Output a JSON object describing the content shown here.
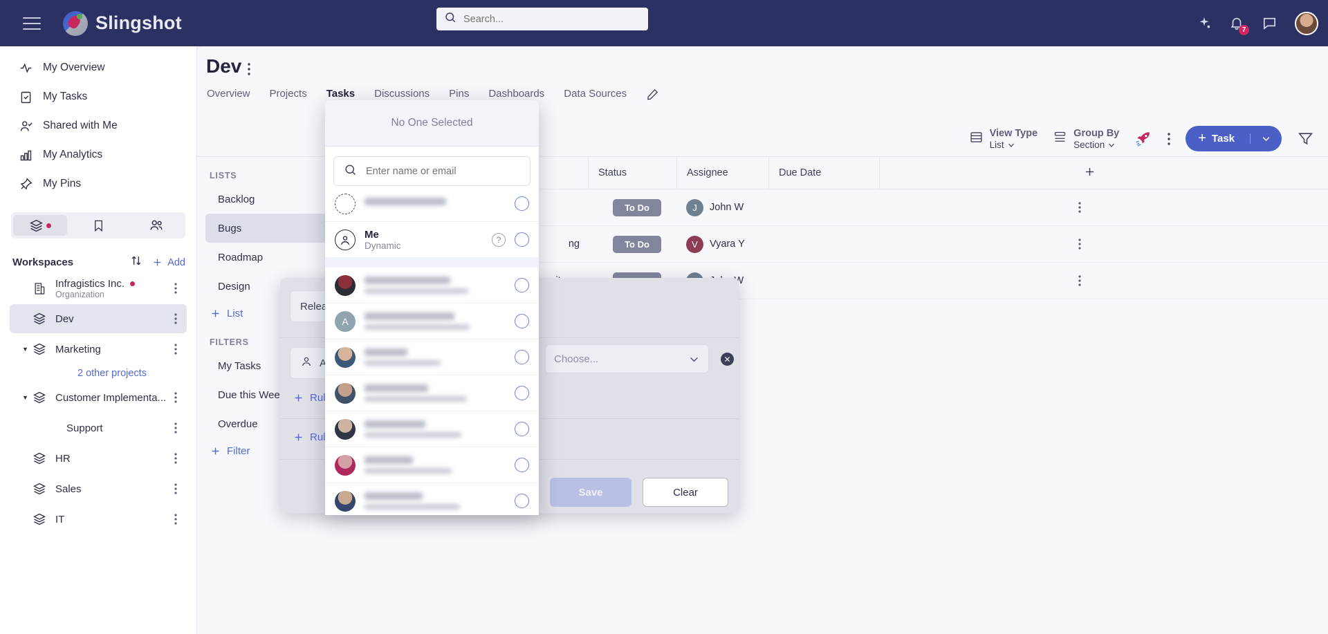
{
  "app": {
    "name": "Slingshot",
    "menu_icon": "hamburger-icon",
    "logo_icon": "slingshot-rocket-logo"
  },
  "search": {
    "placeholder": "Search...",
    "value": "",
    "icon": "search-icon"
  },
  "topbar_icons": {
    "ai_label": "sparkle-icon",
    "notifications_label": "bell-icon",
    "notifications_count": "7",
    "chat_label": "chat-icon",
    "avatar_label": "user-avatar"
  },
  "sidebar": {
    "nav": [
      {
        "label": "My Overview",
        "icon": "activity-icon"
      },
      {
        "label": "My Tasks",
        "icon": "clipboard-check-icon"
      },
      {
        "label": "Shared with Me",
        "icon": "user-check-icon"
      },
      {
        "label": "My Analytics",
        "icon": "bar-chart-icon"
      },
      {
        "label": "My Pins",
        "icon": "pin-icon"
      }
    ],
    "segments": [
      {
        "name": "workspaces-tab",
        "icon": "layers-icon",
        "active": true,
        "dot": true
      },
      {
        "name": "bookmarks-tab",
        "icon": "bookmark-icon",
        "active": false,
        "dot": false
      },
      {
        "name": "people-tab",
        "icon": "people-icon",
        "active": false,
        "dot": false
      }
    ],
    "workspaces_title": "Workspaces",
    "sort_label": "sort-icon",
    "add_label": "Add",
    "items": [
      {
        "label": "Infragistics Inc.",
        "sub": "Organization",
        "icon": "building-icon",
        "dot": true,
        "selected": false,
        "caret": false,
        "indent": 0
      },
      {
        "label": "Dev",
        "sub": "",
        "icon": "layers-icon",
        "dot": false,
        "selected": true,
        "caret": false,
        "indent": 0
      },
      {
        "label": "Marketing",
        "sub": "",
        "icon": "layers-icon",
        "dot": false,
        "selected": false,
        "caret": true,
        "indent": 0
      },
      {
        "label": "Customer Implementa...",
        "sub": "",
        "icon": "layers-icon",
        "dot": false,
        "selected": false,
        "caret": true,
        "indent": 0
      },
      {
        "label": "Support",
        "sub": "",
        "icon": "",
        "dot": false,
        "selected": false,
        "caret": false,
        "indent": 1
      },
      {
        "label": "HR",
        "sub": "",
        "icon": "layers-icon",
        "dot": false,
        "selected": false,
        "caret": false,
        "indent": 0
      },
      {
        "label": "Sales",
        "sub": "",
        "icon": "layers-icon",
        "dot": false,
        "selected": false,
        "caret": false,
        "indent": 0
      },
      {
        "label": "IT",
        "sub": "",
        "icon": "layers-icon",
        "dot": false,
        "selected": false,
        "caret": false,
        "indent": 0
      }
    ],
    "other_projects": "2 other projects"
  },
  "main": {
    "title": "Dev",
    "tabs": [
      {
        "label": "Overview",
        "active": false
      },
      {
        "label": "Projects",
        "active": false
      },
      {
        "label": "Tasks",
        "active": true
      },
      {
        "label": "Discussions",
        "active": false
      },
      {
        "label": "Pins",
        "active": false
      },
      {
        "label": "Dashboards",
        "active": false
      },
      {
        "label": "Data Sources",
        "active": false
      }
    ],
    "edit_icon": "pencil-icon"
  },
  "toolbar": {
    "view_type_label": "View Type",
    "view_type_value": "List",
    "view_type_icon": "list-view-icon",
    "group_by_label": "Group By",
    "group_by_value": "Section",
    "group_by_icon": "group-by-icon",
    "boost_icon": "rocket-icon",
    "more_icon": "more-vertical-icon",
    "task_button": "Task",
    "task_button_plus": "+",
    "task_dropdown_icon": "chevron-down-icon",
    "filter_icon": "filter-icon"
  },
  "lists_panel": {
    "lists_caption": "LISTS",
    "lists": [
      {
        "label": "Backlog",
        "selected": false
      },
      {
        "label": "Bugs",
        "selected": true
      },
      {
        "label": "Roadmap",
        "selected": false
      },
      {
        "label": "Design",
        "selected": false
      }
    ],
    "add_list": "List",
    "filters_caption": "FILTERS",
    "filters": [
      {
        "label": "My Tasks"
      },
      {
        "label": "Due this Week"
      },
      {
        "label": "Overdue"
      }
    ],
    "add_filter": "Filter"
  },
  "table": {
    "columns": [
      "Status",
      "Assignee",
      "Due Date"
    ],
    "add_column_icon": "plus-icon",
    "rows": [
      {
        "name": "",
        "status": "To Do",
        "assignee": "John W",
        "assignee_initial": "J",
        "avatar_color": "#6f8091",
        "due": ""
      },
      {
        "name": "ng",
        "status": "To Do",
        "assignee": "Vyara Y",
        "assignee_initial": "V",
        "avatar_color": "#8e3b54",
        "due": ""
      },
      {
        "name": "items",
        "status": "To Do",
        "assignee": "John W",
        "assignee_initial": "J",
        "avatar_color": "#6f8091",
        "due": ""
      }
    ],
    "row_menu_icon": "more-vertical-icon"
  },
  "filter_modal": {
    "release_field": "Relea",
    "assignee_field_icon": "person-icon",
    "assignee_field_text": "A",
    "choose_placeholder": "Choose...",
    "choose_caret": "chevron-down-icon",
    "remove_icon": "remove-circle-icon",
    "rule_link_1": "Rule",
    "rule_link_2": "Rule",
    "save_label": "Save",
    "clear_label": "Clear"
  },
  "assignee_popup": {
    "header": "No One Selected",
    "search_placeholder": "Enter name or email",
    "search_value": "",
    "search_icon": "search-icon",
    "items": [
      {
        "name": "",
        "sub": "",
        "type": "unassigned",
        "avatar": "dashed-circle",
        "redacted": true,
        "name_w": 118,
        "mail_w": 0
      },
      {
        "name": "Me",
        "sub": "Dynamic",
        "type": "dynamic",
        "avatar": "person-outline",
        "redacted": false,
        "help": true
      },
      {
        "name": "",
        "sub": "",
        "type": "person",
        "avatar": "photo-1",
        "redacted": true,
        "name_w": 124,
        "mail_w": 150
      },
      {
        "name": "",
        "sub": "",
        "type": "person",
        "avatar": "initial-A",
        "avatar_color": "#8fa4ae",
        "initial": "A",
        "redacted": true,
        "name_w": 130,
        "mail_w": 152
      },
      {
        "name": "",
        "sub": "",
        "type": "person",
        "avatar": "photo-2",
        "redacted": true,
        "name_w": 62,
        "mail_w": 110
      },
      {
        "name": "",
        "sub": "",
        "type": "person",
        "avatar": "photo-3",
        "redacted": true,
        "name_w": 92,
        "mail_w": 148
      },
      {
        "name": "",
        "sub": "",
        "type": "person",
        "avatar": "photo-4",
        "redacted": true,
        "name_w": 88,
        "mail_w": 140
      },
      {
        "name": "",
        "sub": "",
        "type": "person",
        "avatar": "photo-5",
        "redacted": true,
        "name_w": 70,
        "mail_w": 126
      },
      {
        "name": "",
        "sub": "",
        "type": "person",
        "avatar": "photo-6",
        "redacted": true,
        "name_w": 84,
        "mail_w": 138
      }
    ]
  },
  "colors": {
    "topbar": "#2b3163",
    "accent": "#4b5fc7",
    "link": "#5468d4",
    "pink_dot": "#c4285e",
    "chip_gray": "#82869c"
  }
}
